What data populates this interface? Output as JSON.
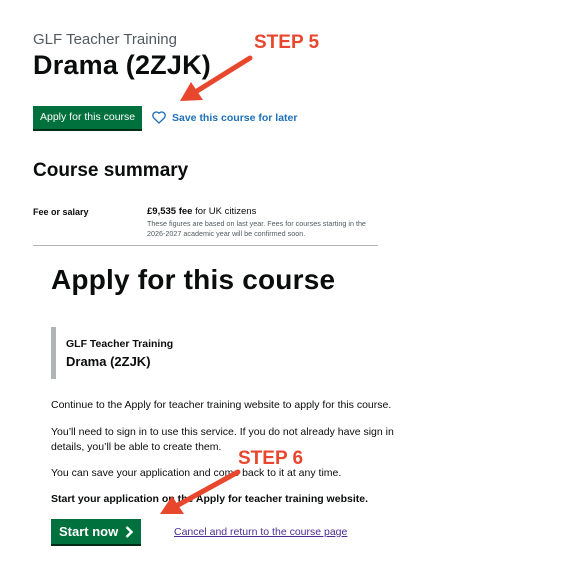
{
  "top": {
    "provider": "GLF Teacher Training",
    "course_title": "Drama (2ZJK)",
    "apply_label": "Apply for this course",
    "save_label": "Save this course for later",
    "summary_heading": "Course summary",
    "fee_label": "Fee or salary",
    "fee_amount": "£9,535 fee",
    "fee_suffix": " for UK citizens",
    "fee_note": "These figures are based on last year. Fees for courses starting in the 2026-2027 academic year will be confirmed soon."
  },
  "bottom": {
    "heading": "Apply for this course",
    "inset_provider": "GLF Teacher Training",
    "inset_course": "Drama (2ZJK)",
    "para1": "Continue to the Apply for teacher training website to apply for this course.",
    "para2": "You’ll need to sign in to use this service. If you do not already have sign in details, you’ll be able to create them.",
    "para3": "You can save your application and come back to it at any time.",
    "para4": "Start your application on the Apply for teacher training website.",
    "start_label": "Start now",
    "cancel_label": "Cancel and return to the course page"
  },
  "annotations": {
    "step5": "STEP 5",
    "step6": "STEP 6",
    "arrow_color": "#e8472d"
  },
  "icons": {
    "save": "heart-icon",
    "start": "chevron-right-icon"
  },
  "colors": {
    "button_green": "#00703c",
    "link_blue": "#1d70b8",
    "visited_purple": "#4c2c92"
  }
}
